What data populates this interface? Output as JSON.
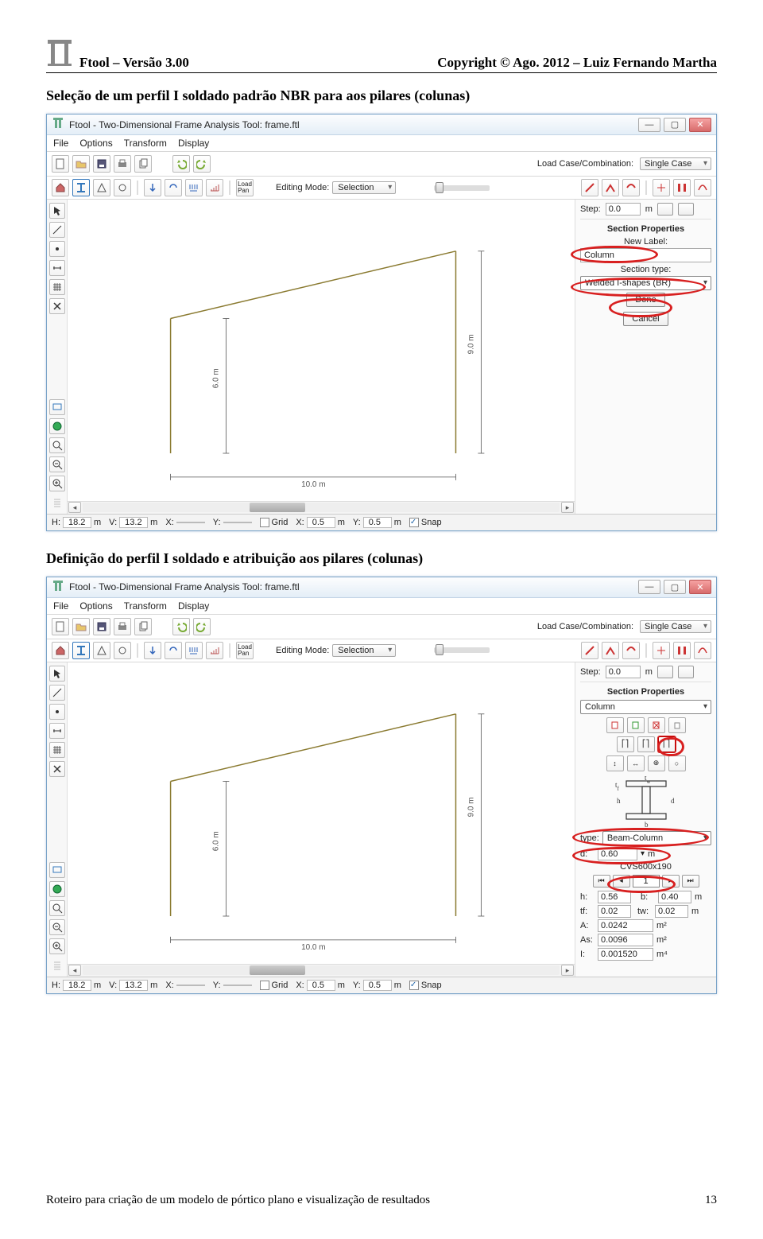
{
  "header": {
    "left": "Ftool – Versão 3.00",
    "right": "Copyright © Ago. 2012 – Luiz Fernando Martha"
  },
  "heading1": "Seleção de um perfil I soldado padrão NBR para aos pilares (colunas)",
  "heading2": "Definição do perfil I soldado e atribuição aos pilares (colunas)",
  "app": {
    "title": "Ftool - Two-Dimensional Frame Analysis Tool: frame.ftl",
    "menus": [
      "File",
      "Options",
      "Transform",
      "Display"
    ],
    "loadCombLabel": "Load Case/Combination:",
    "loadCombValue": "Single Case",
    "editingModeLabel": "Editing Mode:",
    "editingModeValue": "Selection",
    "stepLabel": "Step:",
    "stepValue": "0.0",
    "stepUnit": "m",
    "status": {
      "H": "18.2",
      "Hu": "m",
      "V": "13.2",
      "Vu": "m",
      "X": "",
      "Y": "",
      "grid": "Grid",
      "gX": "0.5",
      "gY": "0.5",
      "gU": "m",
      "snap": "Snap"
    },
    "canvasLabels": {
      "left": "6.0 m",
      "right": "9.0 m",
      "bottom": "10.0 m"
    }
  },
  "panel1": {
    "title": "Section Properties",
    "newLabel": "New Label:",
    "nameValue": "Column",
    "sectionType": "Section type:",
    "sectionTypeValue": "Welded I-shapes (BR)",
    "done": "Done",
    "cancel": "Cancel"
  },
  "panel2": {
    "title": "Section Properties",
    "nameValue": "Column",
    "typeLabel": "type:",
    "typeValue": "Beam-Column",
    "d": "0.60",
    "dU": "m",
    "tableName": "CVS600x190",
    "navNum": "1",
    "h": "0.56",
    "b": "0.40",
    "tf": "0.02",
    "tw": "0.02",
    "A": "0.0242",
    "Au": "m²",
    "As": "0.0096",
    "Asu": "m²",
    "I": "0.001520",
    "Iu": "m⁴"
  },
  "footer": {
    "text": "Roteiro para criação de um modelo de pórtico plano e visualização de resultados",
    "page": "13"
  }
}
